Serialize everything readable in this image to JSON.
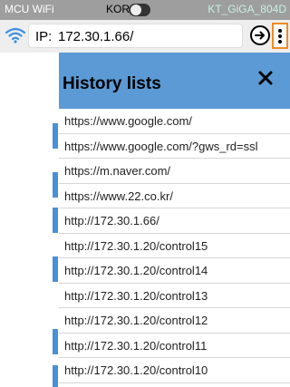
{
  "status": {
    "app_title": "MCU WiFi",
    "kor_label": "KOR",
    "ssid": "KT_GiGA_804D"
  },
  "urlbar": {
    "ip_label": "IP:",
    "ip_value": "172.30.1.66/"
  },
  "history": {
    "title": "History lists",
    "items": [
      "https://www.google.com/",
      "https://www.google.com/?gws_rd=ssl",
      "https://m.naver.com/",
      "https://www.22.co.kr/",
      "http://172.30.1.66/",
      "http://172.30.1.20/control15",
      "http://172.30.1.20/control14",
      "http://172.30.1.20/control13",
      "http://172.30.1.20/control12",
      "http://172.30.1.20/control11",
      "http://172.30.1.20/control10"
    ]
  },
  "colors": {
    "status_bar": "#9e9e9e",
    "ssid_text": "#c8f0e6",
    "header_blue": "#5b9ad5",
    "marker_blue": "#4a90d9",
    "menu_border": "#f08a24"
  },
  "icons": [
    "wifi-icon",
    "go-arrow-icon",
    "more-vert-icon",
    "close-icon"
  ]
}
